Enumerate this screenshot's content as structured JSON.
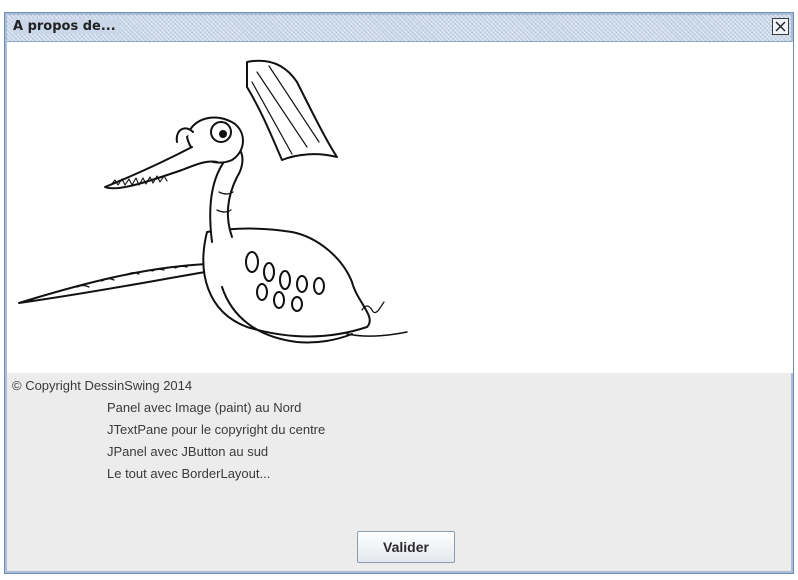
{
  "window": {
    "title": "A propos de...",
    "close_icon": "close-icon"
  },
  "image_panel": {
    "image": "dragon-drawing"
  },
  "text_panel": {
    "copyright": "© Copyright DessinSwing 2014",
    "lines": [
      "Panel avec Image (paint) au Nord",
      "JTextPane pour le copyright du centre",
      "JPanel avec JButton au sud",
      "Le tout avec BorderLayout..."
    ]
  },
  "buttons": {
    "valider_label": "Valider"
  }
}
